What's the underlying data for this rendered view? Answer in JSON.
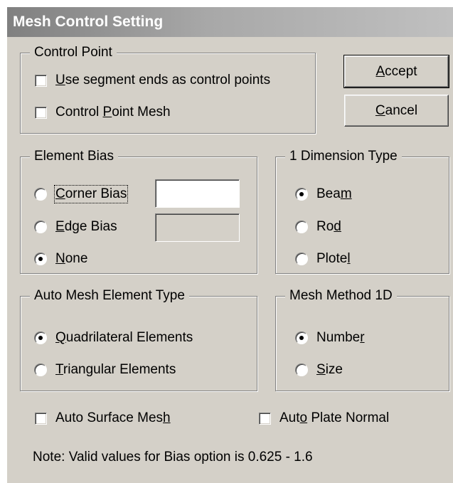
{
  "window": {
    "title": "Mesh Control Setting"
  },
  "control_point": {
    "legend": "Control Point",
    "use_segment_ends": {
      "pre": "",
      "mnemonic": "U",
      "post": "se segment ends as control points",
      "checked": false
    },
    "control_point_mesh": {
      "pre": "Control ",
      "mnemonic": "P",
      "post": "oint Mesh",
      "checked": false
    }
  },
  "buttons": {
    "accept": {
      "pre": "",
      "mnemonic": "A",
      "post": "ccept"
    },
    "cancel": {
      "pre": "",
      "mnemonic": "C",
      "post": "ancel"
    }
  },
  "element_bias": {
    "legend": "Element Bias",
    "corner": {
      "pre": "",
      "mnemonic": "C",
      "post": "orner Bias",
      "selected": false,
      "value": ""
    },
    "edge": {
      "pre": "",
      "mnemonic": "E",
      "post": "dge Bias",
      "selected": false,
      "value": ""
    },
    "none": {
      "pre": "",
      "mnemonic": "N",
      "post": "one",
      "selected": true
    }
  },
  "dimension_type": {
    "legend": "1 Dimension Type",
    "beam": {
      "pre": "Bea",
      "mnemonic": "m",
      "post": "",
      "selected": true
    },
    "rod": {
      "pre": "Ro",
      "mnemonic": "d",
      "post": "",
      "selected": false
    },
    "plotel": {
      "pre": "Plote",
      "mnemonic": "l",
      "post": "",
      "selected": false
    }
  },
  "auto_mesh": {
    "legend": "Auto Mesh Element Type",
    "quad": {
      "pre": "",
      "mnemonic": "Q",
      "post": "uadrilateral Elements",
      "selected": true
    },
    "tri": {
      "pre": "",
      "mnemonic": "T",
      "post": "riangular Elements",
      "selected": false
    }
  },
  "mesh_method": {
    "legend": "Mesh Method 1D",
    "number": {
      "pre": "Numbe",
      "mnemonic": "r",
      "post": "",
      "selected": true
    },
    "size": {
      "pre": "",
      "mnemonic": "S",
      "post": "ize",
      "selected": false
    }
  },
  "options": {
    "auto_surface_mesh": {
      "pre": "Auto Surface Mes",
      "mnemonic": "h",
      "post": "",
      "checked": false
    },
    "auto_plate_normal": {
      "pre": "Aut",
      "mnemonic": "o",
      "post": " Plate Normal",
      "checked": false
    }
  },
  "note": "Note:  Valid values for Bias option is 0.625 - 1.6"
}
